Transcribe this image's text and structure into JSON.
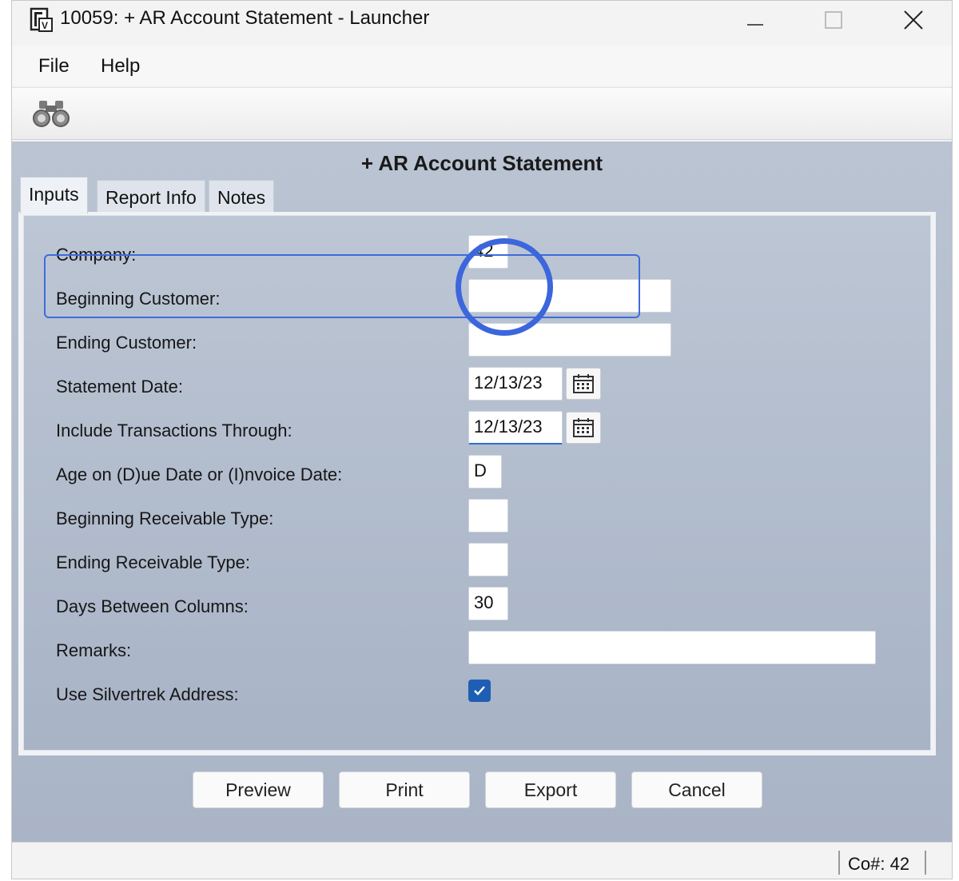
{
  "window": {
    "title": "10059: + AR Account Statement - Launcher"
  },
  "menu": [
    "File",
    "Help"
  ],
  "toolbar": {
    "find_icon": "binoculars-icon"
  },
  "report": {
    "title": "+ AR Account Statement"
  },
  "tabs": [
    "Inputs",
    "Report Info",
    "Notes"
  ],
  "form": {
    "company_label": "Company:",
    "company_value": "42",
    "beg_customer_label": "Beginning Customer:",
    "beg_customer_value": "",
    "end_customer_label": "Ending Customer:",
    "end_customer_value": "",
    "statement_date_label": "Statement Date:",
    "statement_date_value": "12/13/23",
    "include_through_label": "Include Transactions Through:",
    "include_through_value": "12/13/23",
    "age_on_label": "Age on (D)ue Date or (I)nvoice Date:",
    "age_on_value": "D",
    "beg_recv_type_label": "Beginning Receivable Type:",
    "beg_recv_type_value": "",
    "end_recv_type_label": "Ending Receivable Type:",
    "end_recv_type_value": "",
    "days_between_label": "Days Between Columns:",
    "days_between_value": "30",
    "remarks_label": "Remarks:",
    "remarks_value": "",
    "use_silvertrek_label": "Use Silvertrek Address:",
    "use_silvertrek_checked": true
  },
  "buttons": {
    "preview": "Preview",
    "print": "Print",
    "export": "Export",
    "cancel": "Cancel"
  },
  "status": {
    "company": "Co#: 42"
  },
  "colors": {
    "accent": "#3b66dc",
    "checkbox": "#1e5fb4"
  }
}
